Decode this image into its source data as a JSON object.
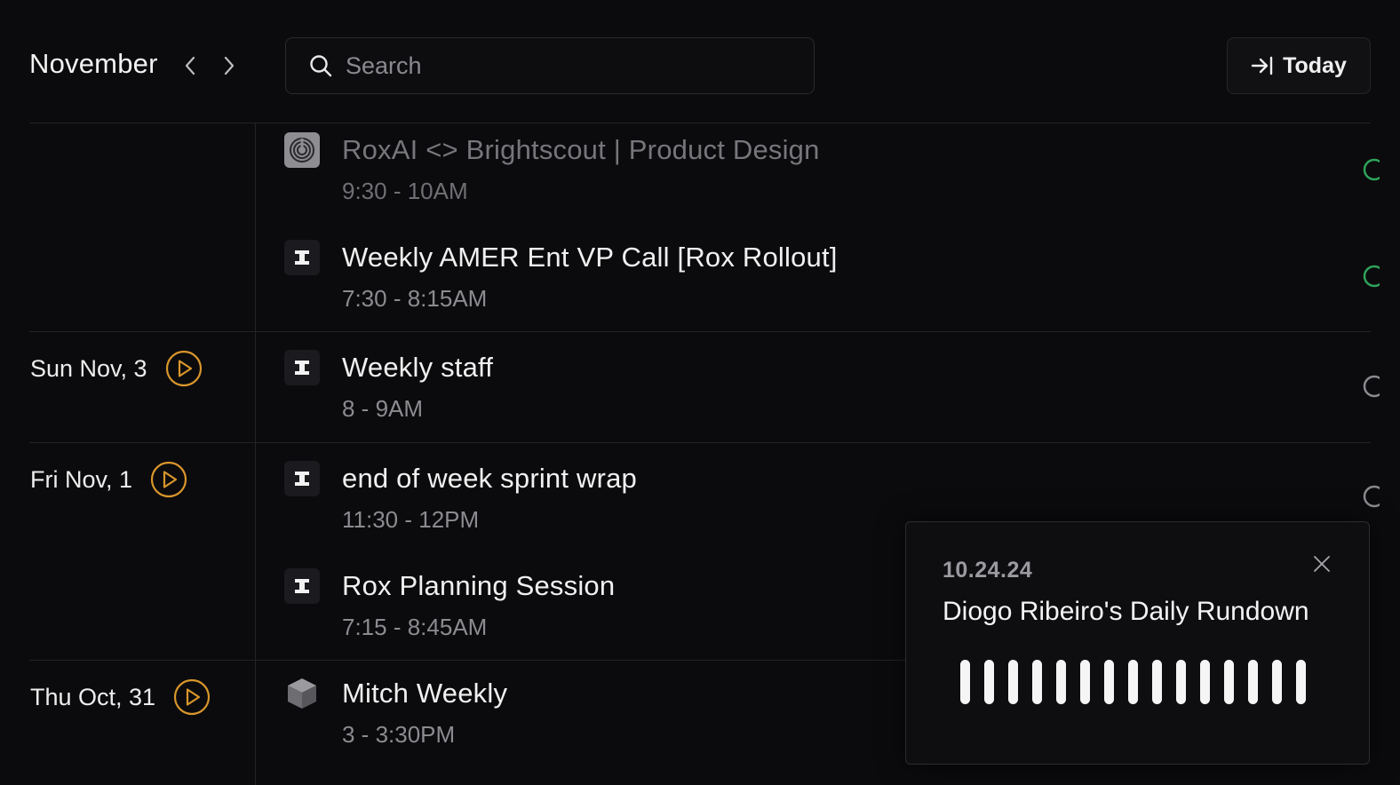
{
  "header": {
    "month": "November",
    "search_placeholder": "Search",
    "today_label": "Today"
  },
  "days": [
    {
      "label": "Sun Nov, 3"
    },
    {
      "label": "Fri Nov, 1"
    },
    {
      "label": "Thu Oct, 31"
    }
  ],
  "events": [
    {
      "title": "RoxAI <> Brightscout | Product Design",
      "time": "9:30 - 10AM",
      "icon": "brightscout-logo-icon"
    },
    {
      "title": "Weekly AMER Ent VP Call [Rox Rollout]",
      "time": "7:30 - 8:15AM",
      "icon": "rox-logo-icon"
    },
    {
      "title": "Weekly staff",
      "time": "8 - 9AM",
      "icon": "rox-logo-icon"
    },
    {
      "title": "end of week sprint wrap",
      "time": "11:30 - 12PM",
      "icon": "rox-logo-icon"
    },
    {
      "title": "Rox Planning Session",
      "time": "7:15 - 8:45AM",
      "icon": "rox-logo-icon"
    },
    {
      "title": "Mitch Weekly",
      "time": "3 - 3:30PM",
      "icon": "cube-icon"
    }
  ],
  "popup": {
    "date": "10.24.24",
    "title": "Diogo Ribeiro's Daily Rundown",
    "waveform_bars": 15
  },
  "colors": {
    "background": "#0b0b0d",
    "accent_play": "#d9962b",
    "status_green": "#2fa35a"
  }
}
